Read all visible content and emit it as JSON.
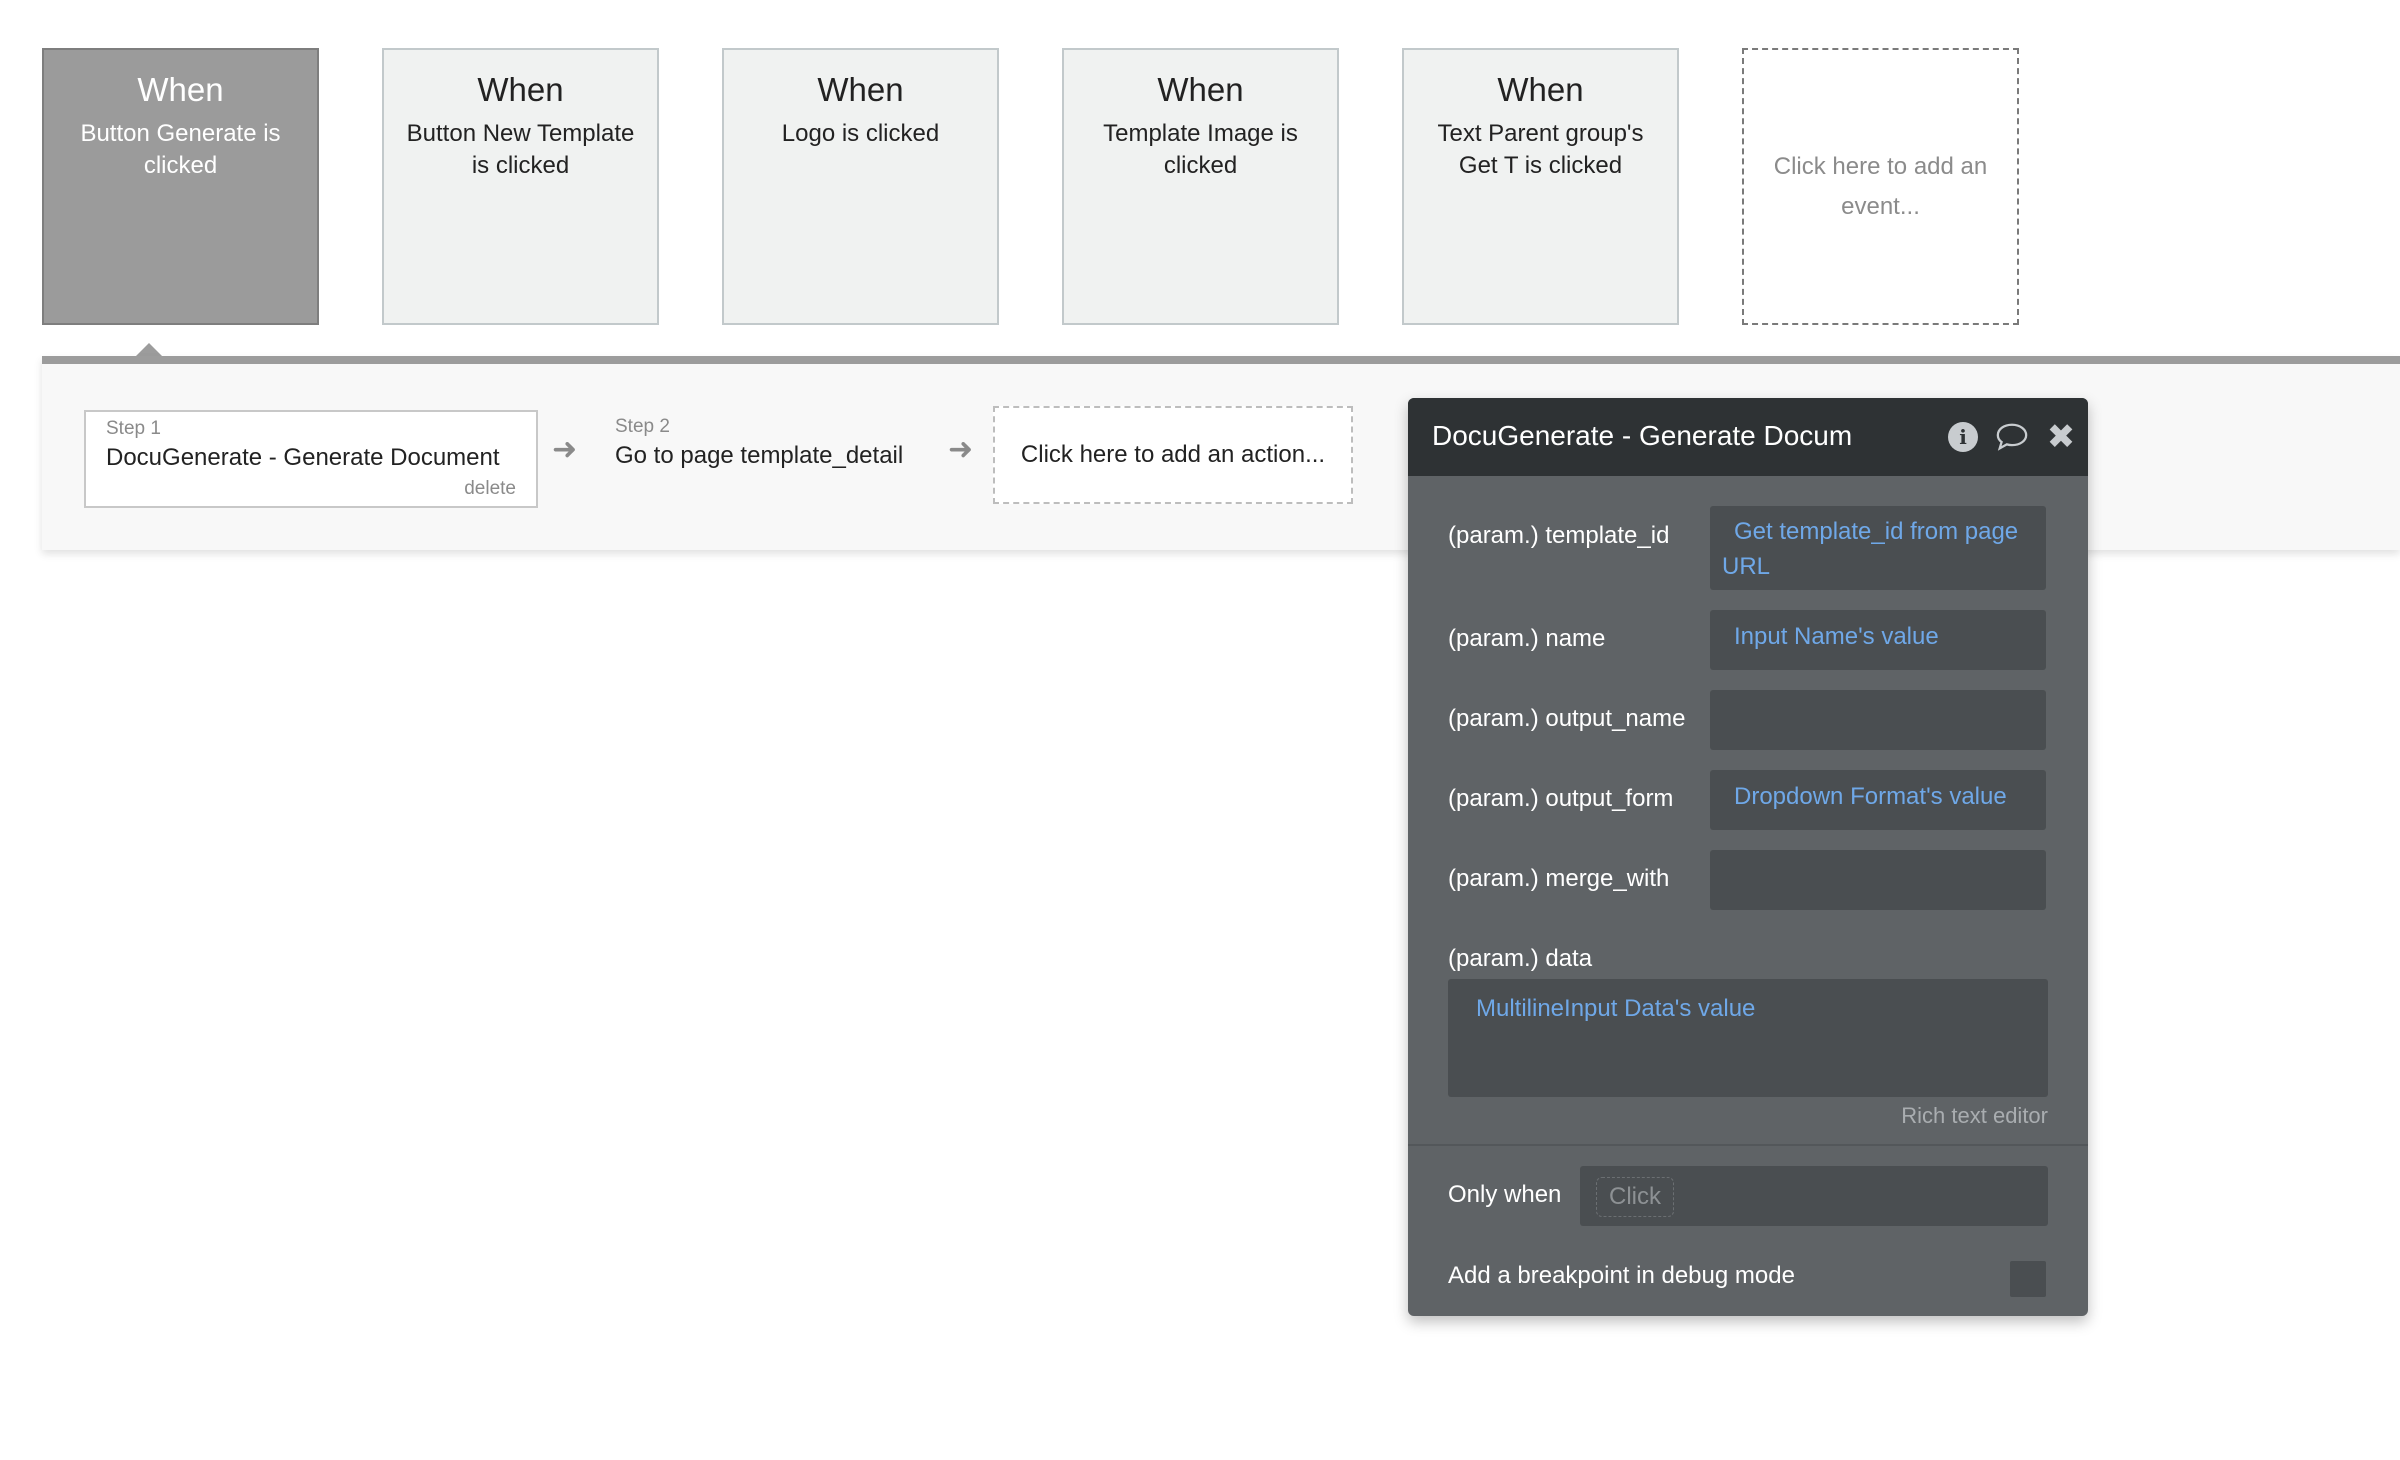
{
  "events": [
    {
      "when": "When",
      "text": "Button Generate is clicked"
    },
    {
      "when": "When",
      "text": "Button New Template is clicked"
    },
    {
      "when": "When",
      "text": "Logo is clicked"
    },
    {
      "when": "When",
      "text": "Template Image is clicked"
    },
    {
      "when": "When",
      "text": "Text Parent group's Get T is clicked"
    }
  ],
  "add_event": "Click here to add an event...",
  "steps": [
    {
      "label": "Step 1",
      "name": "DocuGenerate - Generate Document",
      "delete": "delete"
    },
    {
      "label": "Step 2",
      "name": "Go to page template_detail"
    }
  ],
  "add_action": "Click here to add an action...",
  "panel": {
    "title": "DocuGenerate - Generate Document",
    "params": {
      "template_id": {
        "label": "(param.) template_id",
        "value": "Get template_id from page URL"
      },
      "name": {
        "label": "(param.) name",
        "value": "Input Name's value"
      },
      "output_name": {
        "label": "(param.) output_name",
        "value": ""
      },
      "output_form": {
        "label": "(param.) output_form",
        "value": "Dropdown Format's value"
      },
      "merge_with": {
        "label": "(param.) merge_with",
        "value": ""
      },
      "data": {
        "label": "(param.) data",
        "value": "MultilineInput Data's value"
      }
    },
    "rich_text_editor": "Rich text editor",
    "only_when_label": "Only when",
    "only_when_placeholder": "Click",
    "breakpoint_label": "Add a breakpoint in debug mode"
  },
  "icons": {
    "info": "info-icon",
    "comment": "comment-icon",
    "close": "close-icon",
    "arrow": "arrow-right-icon"
  }
}
